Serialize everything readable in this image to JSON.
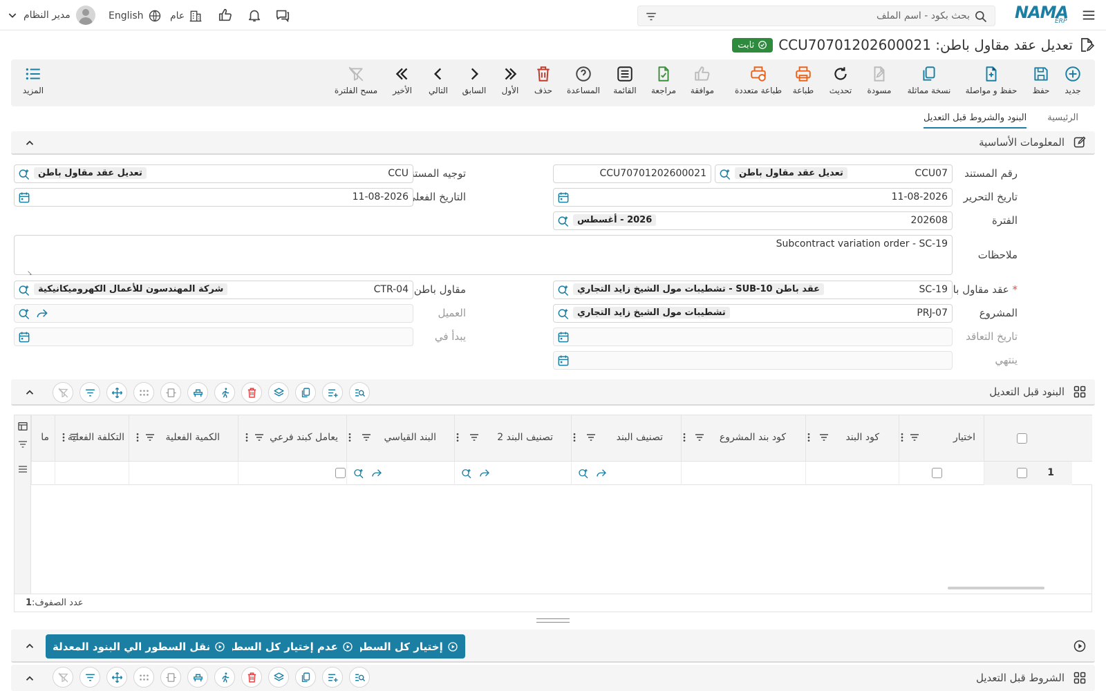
{
  "topbar": {
    "search_placeholder": "بحث بكود - اسم الملف",
    "user": "مدير النظام",
    "language": "English",
    "branch": "عام",
    "logo": "NAMA",
    "logo_sub": "ERP"
  },
  "page": {
    "title": "تعديل عقد مقاول باطن: CCU70701202600021",
    "status": "ثابت"
  },
  "toolbar": {
    "new": "جديد",
    "save": "حفظ",
    "save_continue": "حفظ و مواصلة",
    "copy": "نسخة مماثلة",
    "draft": "مسودة",
    "refresh": "تحديث",
    "print": "طباعة",
    "multi_print": "طباعة متعددة",
    "approve": "موافقة",
    "review": "مراجعة",
    "list": "القائمة",
    "help": "المساعدة",
    "delete": "حذف",
    "first": "الأول",
    "prev": "السابق",
    "next": "التالي",
    "last": "الأخير",
    "clear_filter": "مسح الفلترة",
    "more": "المزيد"
  },
  "tabs": [
    {
      "label": "الرئيسية",
      "active": false
    },
    {
      "label": "البنود والشروط قبل التعديل",
      "active": true
    }
  ],
  "sections": {
    "basic": "المعلومات الأساسية",
    "items_before": "البنود قبل التعديل",
    "terms_before": "الشروط قبل التعديل"
  },
  "form": {
    "doc_no_label": "رقم المستند",
    "doc_no_code": "CCU07",
    "doc_no_type": "تعديل عقد مقاول باطن",
    "doc_no_value": "CCU70701202600021",
    "doc_direction_label": "توجيه المستند",
    "doc_direction_code": "CCU",
    "doc_direction_name": "تعديل عقد مقاول باطن",
    "issue_date_label": "تاريخ التحرير",
    "issue_date": "11-08-2026",
    "actual_date_label": "التاريخ الفعلي",
    "actual_date": "11-08-2026",
    "period_label": "الفترة",
    "period_code": "202608",
    "period_name": "2026 - أغسطس",
    "notes_label": "ملاحظات",
    "notes": "Subcontract variation order - SC-19",
    "contract_label": "عقد مقاول باطن",
    "contract_code": "SC-19",
    "contract_name": "عقد باطن SUB-10 - تشطيبات مول الشيخ زايد التجاري",
    "subcontractor_label": "مقاول باطن",
    "subcontractor_code": "CTR-04",
    "subcontractor_name": "شركة المهندسون للأعمال الكهروميكانيكية",
    "project_label": "المشروع",
    "project_code": "PRJ-07",
    "project_name": "تشطيبات مول الشيخ زايد التجاري",
    "customer_label": "العميل",
    "contract_date_label": "تاريخ التعاقد",
    "starts_label": "يبدأ في",
    "ends_label": "ينتهي"
  },
  "grid": {
    "columns": [
      "اختيار",
      "كود البند",
      "كود بند المشروع",
      "تصنيف البند",
      "تصنيف البند 2",
      "البند القياسي",
      "يعامل كبند فرعي",
      "الكمية الفعلية",
      "التكلفة الفعلية",
      "ما"
    ],
    "row_number": "1",
    "rows_count_label": "عدد الصفوف:",
    "rows_count": "1"
  },
  "actions": {
    "select_all": "إختيار كل السطور",
    "deselect_all": "عدم إختيار كل السطور",
    "move_lines": "نقل السطور الي البنود المعدلة"
  },
  "colors": {
    "accent": "#1a7fa3",
    "badge": "#2e8b3e",
    "print_orange": "#e8631c",
    "review_green": "#3c8f3c",
    "delete_red": "#c0392b"
  }
}
